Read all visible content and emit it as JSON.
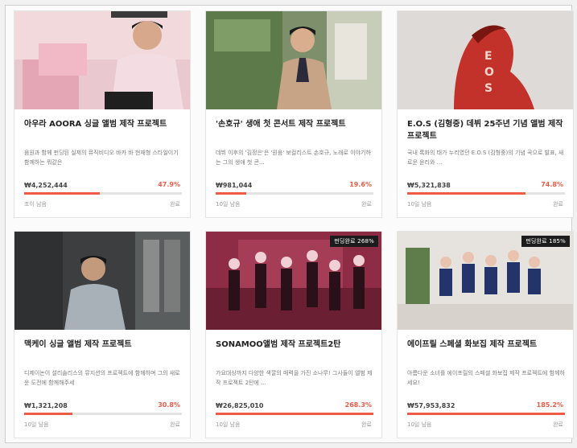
{
  "projects": [
    {
      "title": "아우라 AOORA 싱글 앨범 제작 프로젝트",
      "desc": "음원과 함께 펀딩된 실제의 뮤직비디오 바카 바 현재형 스타일이기 함께하는 뭐같은",
      "amount": "₩4,252,444",
      "percent": "47.9%",
      "progress": 0.479,
      "meta": "조이 남음",
      "status": "완료",
      "badge": ""
    },
    {
      "title": "'손호규' 생애 첫 콘서트 제작 프로젝트",
      "desc": "데뷔 이후의 '김정은'은 '원음' 보컬리스트 손호규, 노래로 이야기하는 그의 생애 첫 콘...",
      "amount": "₩981,044",
      "percent": "19.6%",
      "progress": 0.196,
      "meta": "10일 남음",
      "status": "완료",
      "badge": ""
    },
    {
      "title": "E.O.S (김형중) 데뷔 25주년 기념 앨범 제작 프로젝트",
      "desc": "국내 록화의 태가 누리였던 E.O.S (김형중)의 기념 곡으로 발표, 새로운 윤리와 ...",
      "amount": "₩5,321,838",
      "percent": "74.8%",
      "progress": 0.748,
      "meta": "10일 남음",
      "status": "완료",
      "badge": ""
    },
    {
      "title": "맥케이 싱글 앨범 제작 프로젝트",
      "desc": "디제이논이 설리솔리스의 뮤지션의 프로젝트에 함께하며 그의 새로운 도전에 함께해주세",
      "amount": "₩1,321,208",
      "percent": "30.8%",
      "progress": 0.308,
      "meta": "10일 남음",
      "status": "완료",
      "badge": ""
    },
    {
      "title": "SONAMOO앨범 제작 프로젝트2탄",
      "desc": "가요대상까지 다양한 색깔의 매력을 가진 소나무! 그사들이 앨범 제작 프로젝트 2탄에 ...",
      "amount": "₩26,825,010",
      "percent": "268.3%",
      "progress": 1.0,
      "meta": "10일 남음",
      "status": "완료",
      "badge": "펀딩완료 268%"
    },
    {
      "title": "에이프릴 스페셜 화보집 제작 프로젝트",
      "desc": "아름다운 소녀를 에이프릴의 스페셜 화보집 제작 프로젝트에 함께하세요!",
      "amount": "₩57,953,832",
      "percent": "185.2%",
      "progress": 1.0,
      "meta": "10일 남음",
      "status": "완료",
      "badge": "펀딩완료 185%"
    }
  ],
  "colors": {
    "accent": "#ee5b47",
    "track": "#e3e3e3",
    "badge_bg": "#1c1c1c"
  }
}
